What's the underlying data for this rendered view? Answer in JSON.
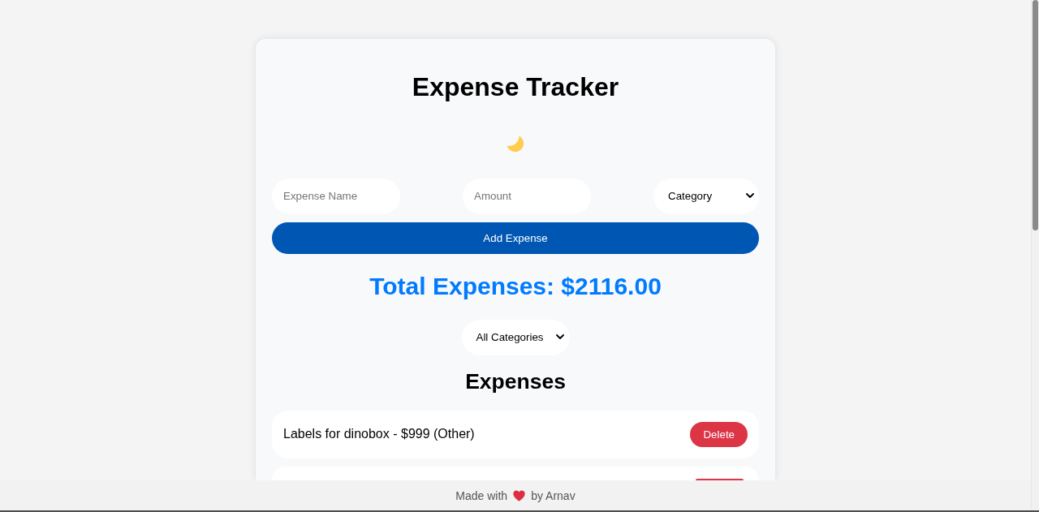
{
  "title": "Expense Tracker",
  "form": {
    "name_field": {
      "placeholder": "Expense Name"
    },
    "amount_field": {
      "placeholder": "Amount"
    },
    "category_select": {
      "value": "Category"
    },
    "add_button": "Add Expense"
  },
  "total": "Total Expenses: $2116.00",
  "filter": {
    "value": "All Categories"
  },
  "list_title": "Expenses",
  "expenses": [
    {
      "kind": "entry",
      "label": "Labels for dinobox - $999 (Other)",
      "delete_button": "Delete"
    },
    {
      "kind": "cut-off"
    }
  ],
  "footer": {
    "text_before": "Made with",
    "text_after": "by Arnav"
  }
}
